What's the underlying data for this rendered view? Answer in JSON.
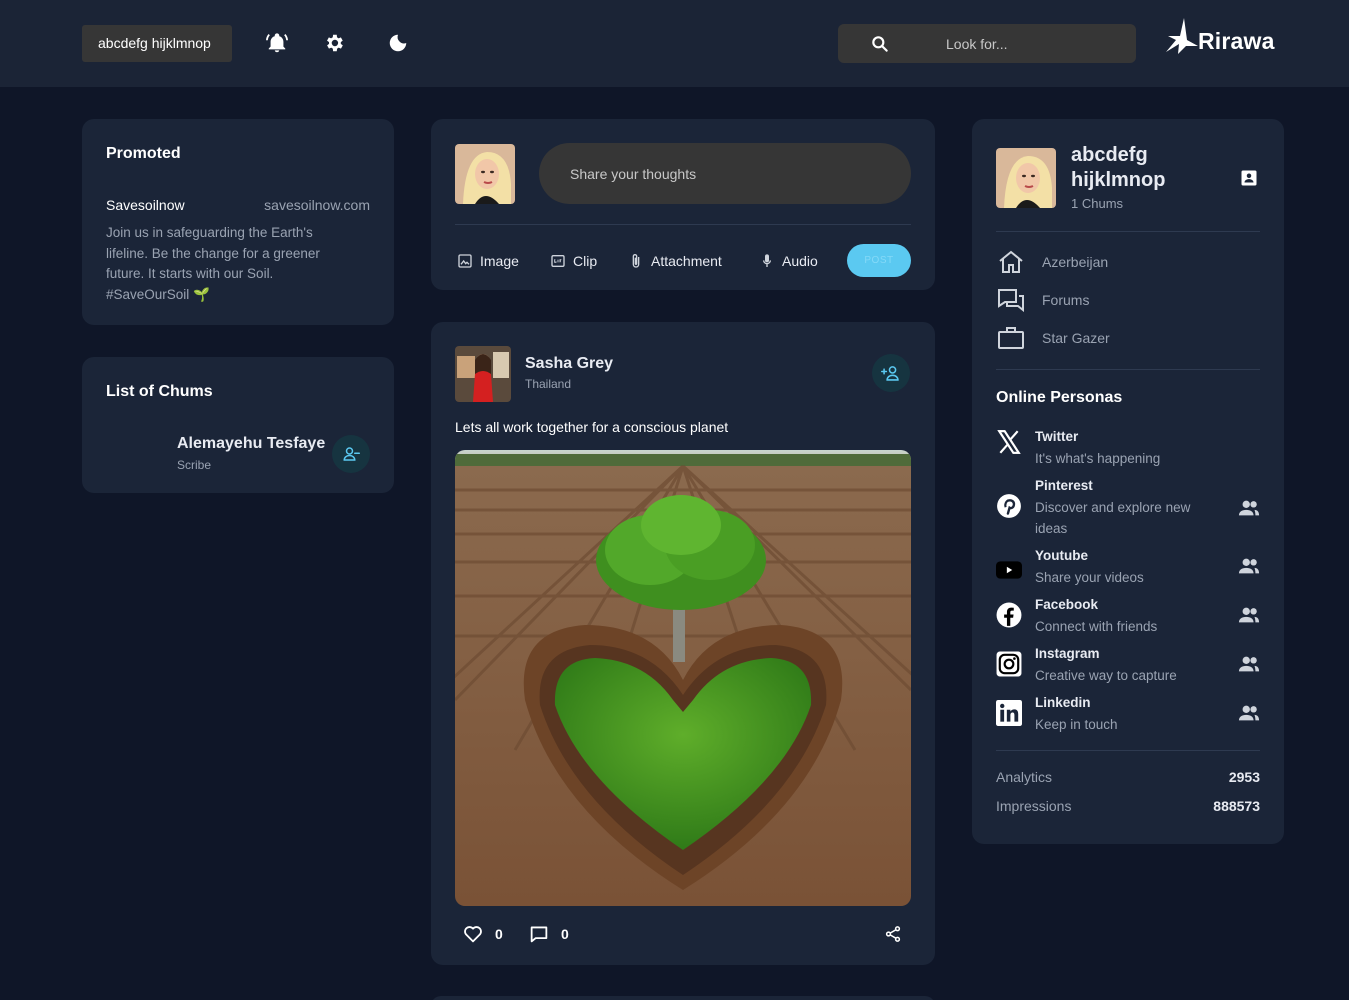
{
  "topbar": {
    "user_chip": "abcdefg hijklmnop",
    "search_placeholder": "Look for...",
    "logo_text": "Rirawa"
  },
  "promoted": {
    "title": "Promoted",
    "name": "Savesoilnow",
    "url": "savesoilnow.com",
    "body": "Join us in safeguarding the Earth's lifeline. Be the change for a greener future. It starts with our Soil. #SaveOurSoil 🌱"
  },
  "chums": {
    "title": "List of Chums",
    "items": [
      {
        "name": "Alemayehu Tesfaye",
        "role": "Scribe"
      }
    ]
  },
  "composer": {
    "placeholder": "Share your thoughts",
    "buttons": [
      "Image",
      "Clip",
      "Attachment",
      "Audio"
    ],
    "post_label": "POST"
  },
  "post": {
    "author": "Sasha Grey",
    "location": "Thailand",
    "text": "Lets all work together for a conscious planet",
    "likes": "0",
    "comments": "0"
  },
  "profile": {
    "name": "abcdefg hijklmnop",
    "chums": "1 Chums",
    "nav": [
      "Azerbeijan",
      "Forums",
      "Star Gazer"
    ],
    "online_title": "Online Personas",
    "socials": [
      {
        "name": "Twitter",
        "desc": "It's what's happening",
        "icon": "x-icon"
      },
      {
        "name": "Pinterest",
        "desc": "Discover and explore new ideas",
        "icon": "pinterest-icon"
      },
      {
        "name": "Youtube",
        "desc": "Share your videos",
        "icon": "youtube-icon"
      },
      {
        "name": "Facebook",
        "desc": "Connect with friends",
        "icon": "facebook-icon"
      },
      {
        "name": "Instagram",
        "desc": "Creative way to capture",
        "icon": "instagram-icon"
      },
      {
        "name": "Linkedin",
        "desc": "Keep in touch",
        "icon": "linkedin-icon"
      }
    ],
    "stats": [
      {
        "label": "Analytics",
        "value": "2953"
      },
      {
        "label": "Impressions",
        "value": "888573"
      }
    ]
  },
  "colors": {
    "background": "#0f1628",
    "card": "#1b2538",
    "accent": "#5bc9f1",
    "input": "#363636"
  }
}
